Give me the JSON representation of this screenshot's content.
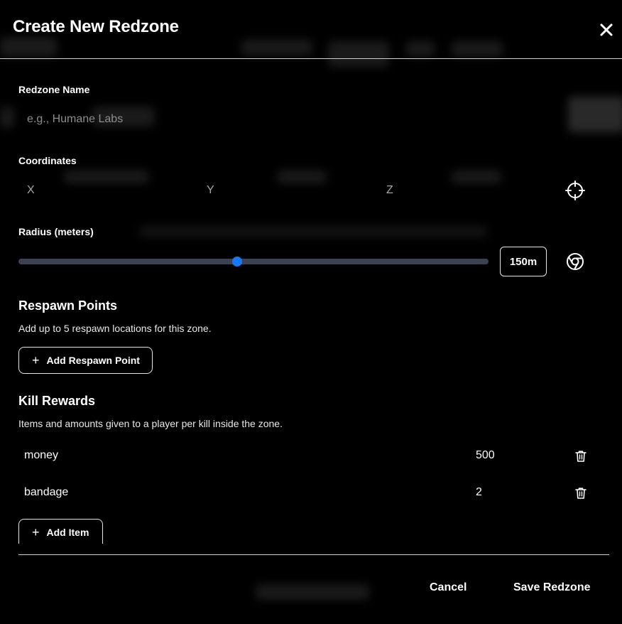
{
  "modal": {
    "title": "Create New Redzone",
    "close_icon": "close-icon"
  },
  "name_field": {
    "label": "Redzone Name",
    "placeholder": "e.g., Humane Labs",
    "value": ""
  },
  "coordinates": {
    "label": "Coordinates",
    "x_placeholder": "X",
    "y_placeholder": "Y",
    "z_placeholder": "Z",
    "locate_icon": "crosshair-icon"
  },
  "radius": {
    "label": "Radius (meters)",
    "value_display": "150m",
    "slider_fraction": 0.465,
    "view_icon": "chrome-icon",
    "accent_color": "#1877f2"
  },
  "respawn": {
    "title": "Respawn Points",
    "description": "Add up to 5 respawn locations for this zone.",
    "add_button": "Add Respawn Point"
  },
  "rewards": {
    "title": "Kill Rewards",
    "description": "Items and amounts given to a player per kill inside the zone.",
    "items": [
      {
        "name": "money",
        "amount": "500"
      },
      {
        "name": "bandage",
        "amount": "2"
      }
    ],
    "delete_icon": "trash-icon",
    "add_button": "Add Item"
  },
  "footer": {
    "cancel_label": "Cancel",
    "save_label": "Save Redzone"
  }
}
